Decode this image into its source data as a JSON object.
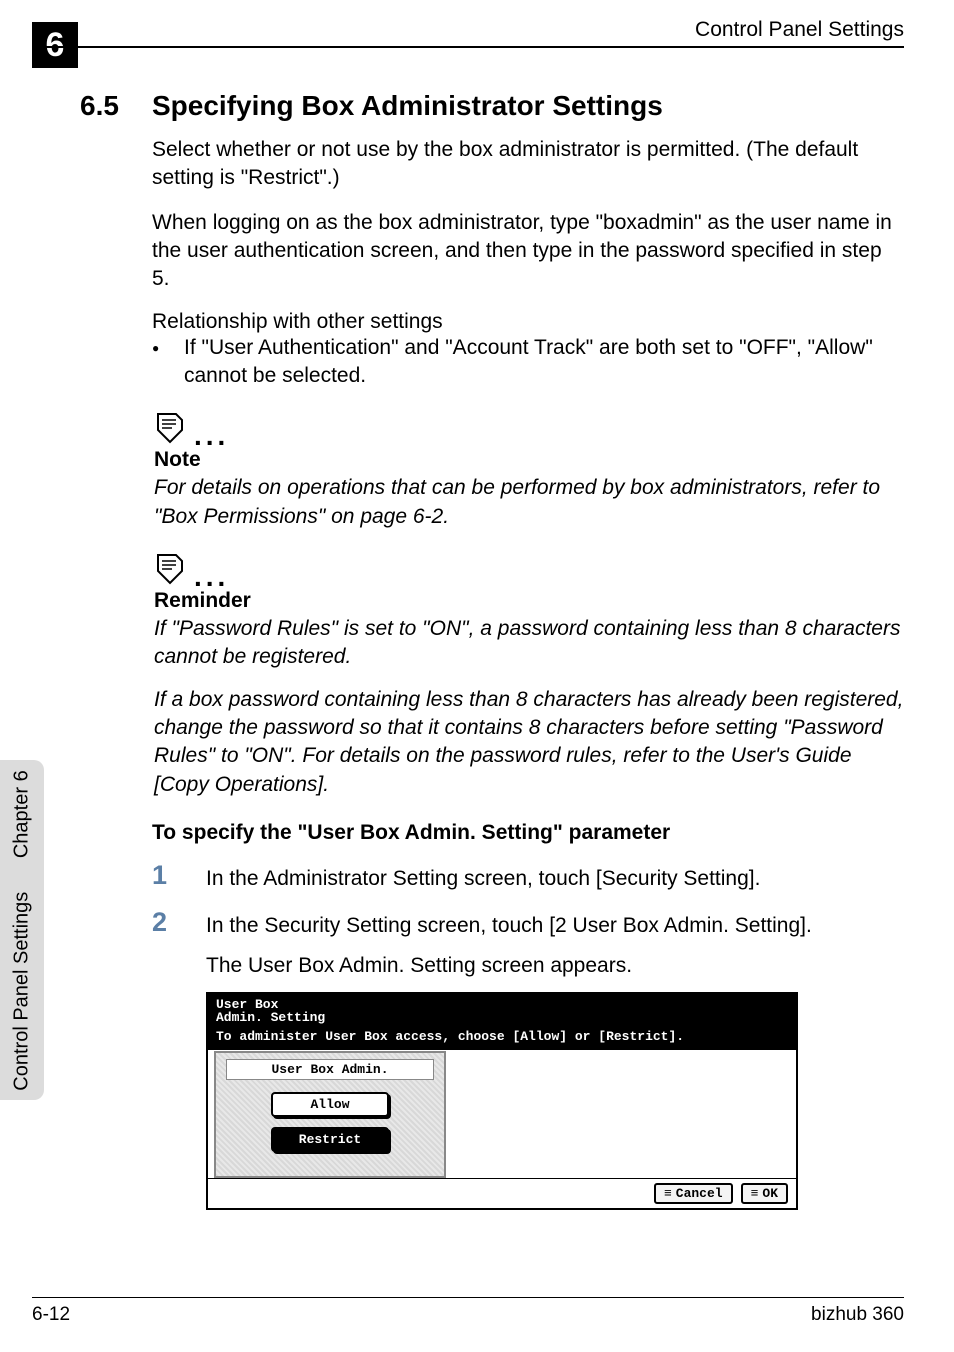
{
  "sidebar": {
    "label": "Control Panel Settings",
    "chapter": "Chapter 6"
  },
  "header": {
    "chapter_num": "6",
    "title": "Control Panel Settings"
  },
  "section": {
    "num": "6.5",
    "title": "Specifying Box Administrator Settings"
  },
  "para1": "Select whether or not use by the box administrator is permitted. (The default setting is \"Restrict\".)",
  "para2": "When logging on as the box administrator, type \"boxadmin\" as the user name in the user authentication screen, and then type in the password specified in step 5.",
  "rel_heading": "Relationship with other settings",
  "bullet1": "If \"User Authentication\" and \"Account Track\" are both set to \"OFF\", \"Allow\" cannot be selected.",
  "note1": {
    "label": "Note",
    "body": "For details on operations that can be performed by box administrators, refer to \"Box Permissions\" on page 6-2."
  },
  "note2": {
    "label": "Reminder",
    "body1": "If \"Password Rules\" is set to \"ON\", a password containing less than 8 characters cannot be registered.",
    "body2": "If a box password containing less than 8 characters has already been registered, change the password so that it contains 8 characters before setting \"Password Rules\" to \"ON\". For details on the password rules, refer to the User's Guide [Copy Operations]."
  },
  "subhead": "To specify the \"User Box Admin. Setting\" parameter",
  "steps": {
    "s1": {
      "num": "1",
      "text": "In the Administrator Setting screen, touch [Security Setting]."
    },
    "s2": {
      "num": "2",
      "text": "In the Security Setting screen, touch [2 User Box Admin. Setting].",
      "sub": "The User Box Admin. Setting screen appears."
    }
  },
  "screenshot": {
    "title1": "User Box",
    "title2": "Admin. Setting",
    "msg": "To administer User Box access, choose [Allow] or [Restrict].",
    "panel_label": "User Box Admin.",
    "btn_allow": "Allow",
    "btn_restrict": "Restrict",
    "btn_cancel": "Cancel",
    "btn_ok": "OK"
  },
  "footer": {
    "left": "6-12",
    "right": "bizhub 360"
  }
}
